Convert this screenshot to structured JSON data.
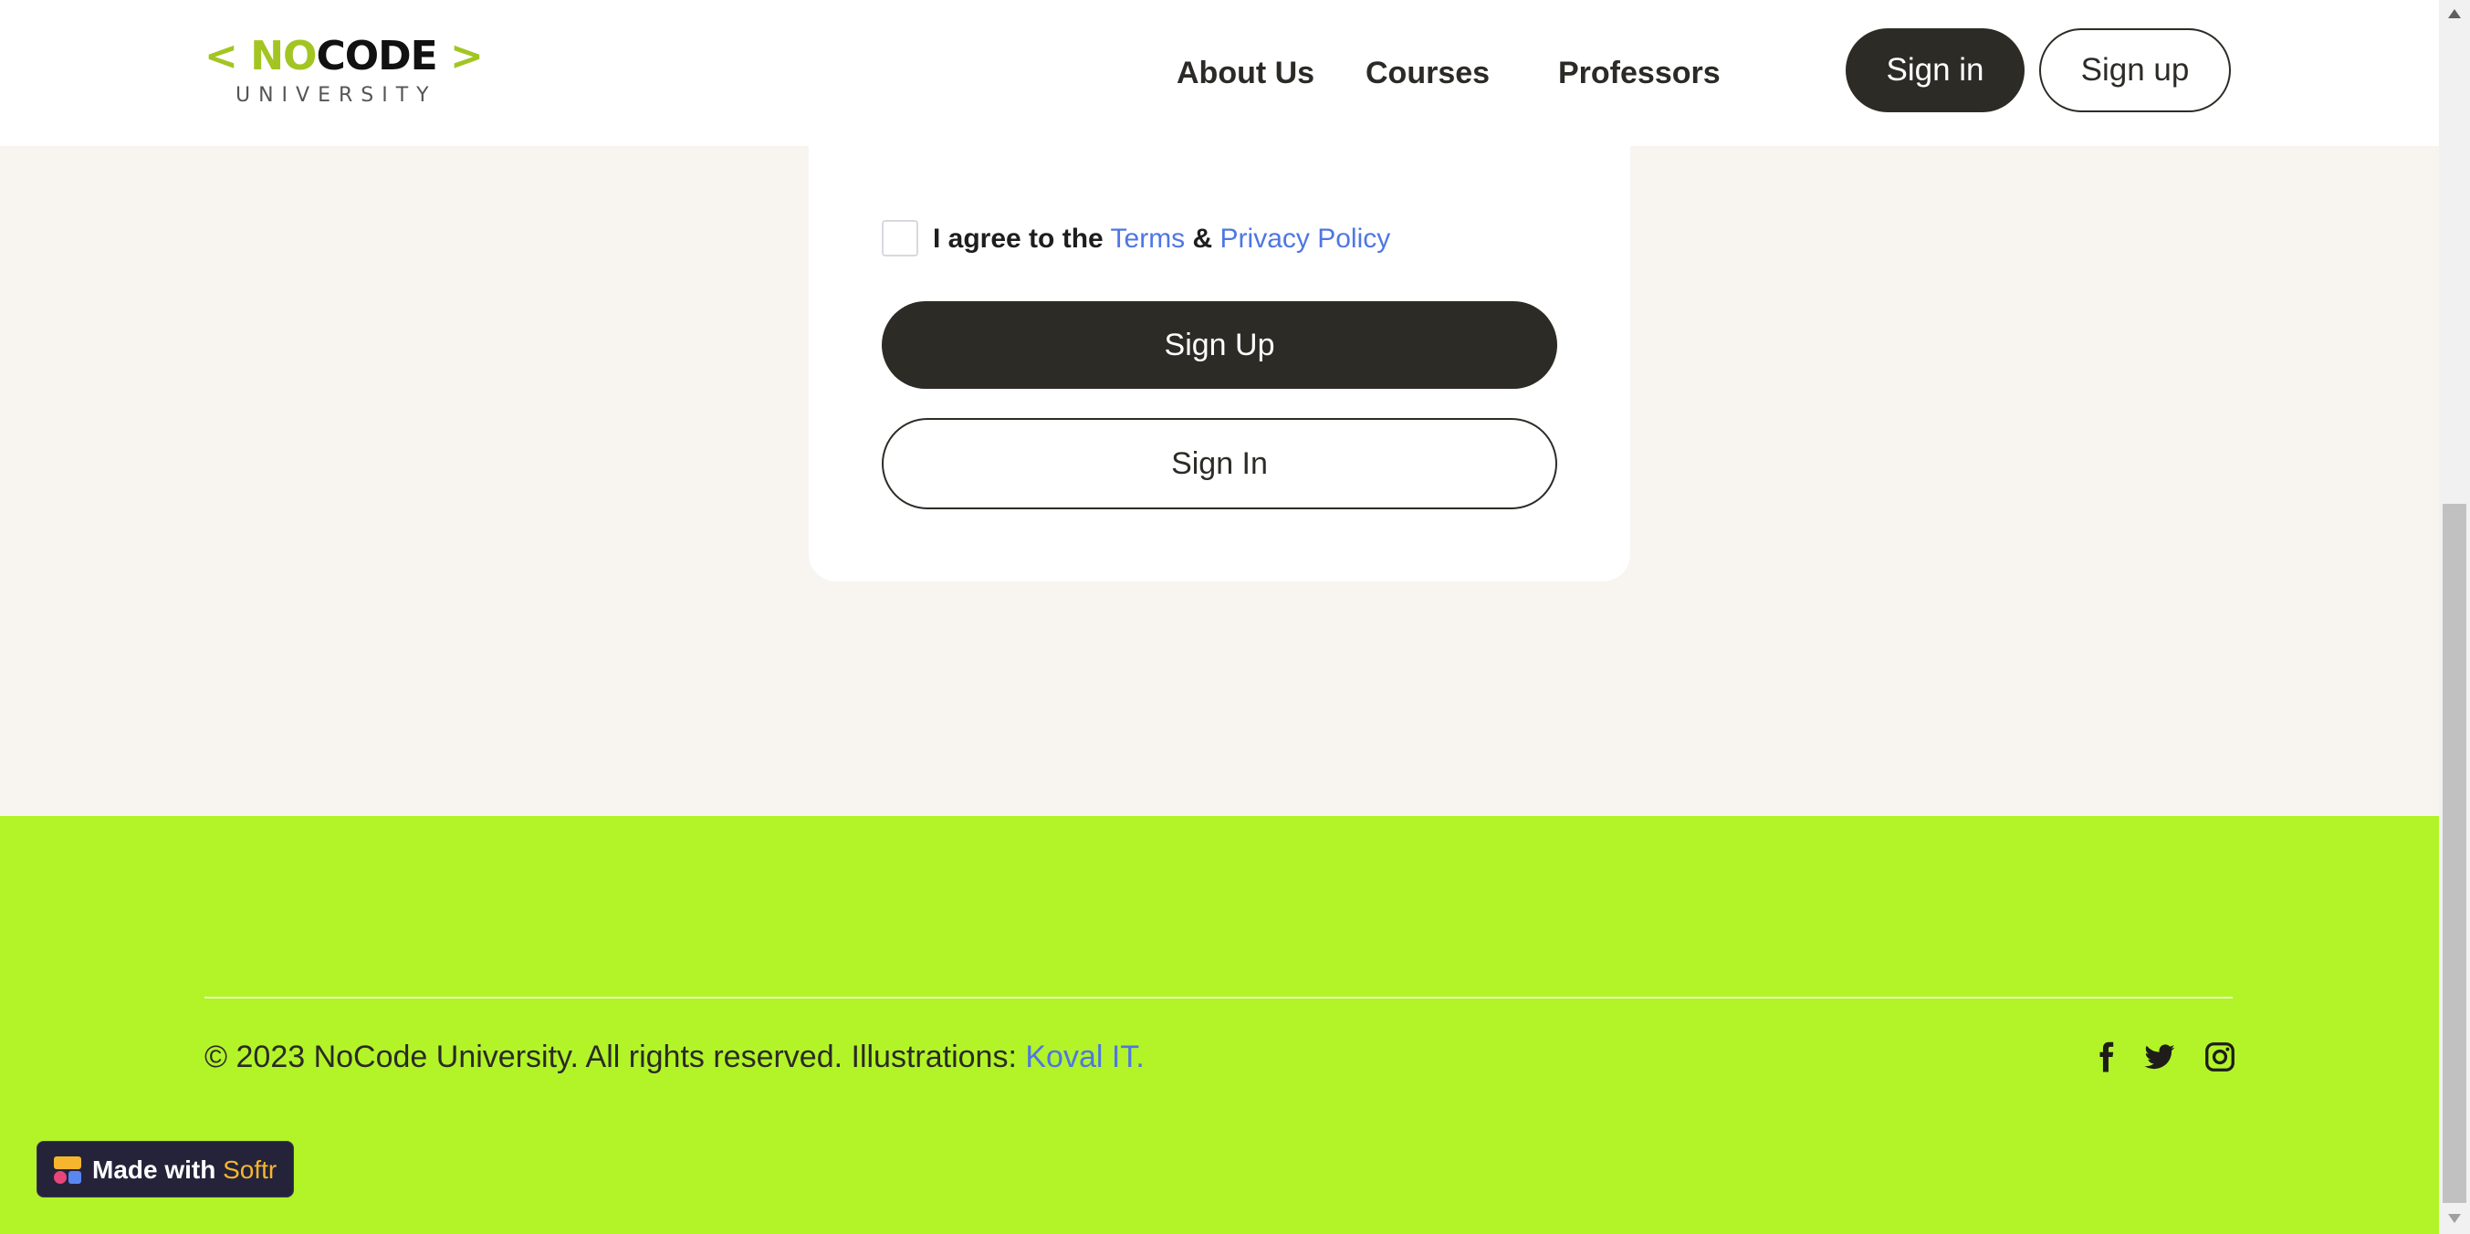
{
  "header": {
    "logo": {
      "bracket_left": "<",
      "no": "NO",
      "code": "CODE",
      "bracket_right": ">",
      "sub": "UNIVERSITY"
    },
    "nav": [
      {
        "label": "About Us"
      },
      {
        "label": "Courses"
      },
      {
        "label": "Professors"
      }
    ],
    "signin_label": "Sign in",
    "signup_label": "Sign up"
  },
  "form": {
    "agree_prefix": "I agree to the",
    "terms_label": "Terms",
    "ampersand": "&",
    "privacy_label": "Privacy Policy",
    "agree_checked": false,
    "signup_button": "Sign Up",
    "signin_button": "Sign In"
  },
  "footer": {
    "copyright": "© 2023 NoCode University. All rights reserved. Illustrations:",
    "credit_link": "Koval IT.",
    "social": [
      "facebook-icon",
      "twitter-icon",
      "instagram-icon"
    ]
  },
  "badge": {
    "made_with": "Made with",
    "brand": "Softr"
  },
  "colors": {
    "accent_green": "#b2f428",
    "logo_green": "#a3c522",
    "dark_button": "#2d2b26",
    "link_blue": "#4f76e3",
    "page_bg": "#f8f5f0"
  }
}
